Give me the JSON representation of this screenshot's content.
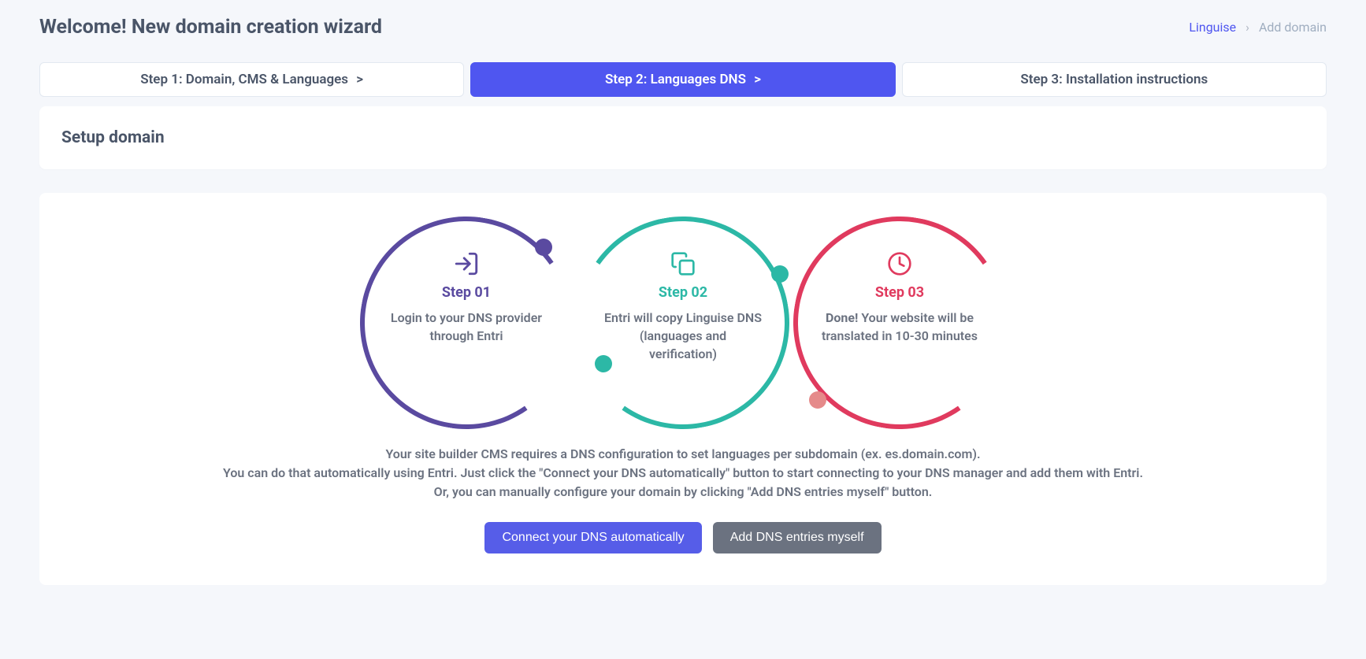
{
  "header": {
    "title": "Welcome! New domain creation wizard"
  },
  "breadcrumb": {
    "root": "Linguise",
    "current": "Add domain"
  },
  "tabs": {
    "step1": "Step 1: Domain, CMS & Languages",
    "step2": "Step 2: Languages DNS",
    "step3": "Step 3: Installation instructions",
    "chevron": ">"
  },
  "card": {
    "title": "Setup domain"
  },
  "diagram": {
    "step1_label": "Step 01",
    "step1_desc": "Login to your DNS provider through Entri",
    "step2_label": "Step 02",
    "step2_desc": "Entri will copy Linguise DNS (languages and verification)",
    "step3_label": "Step 03",
    "step3_strong": "Done!",
    "step3_rest": " Your website will be translated in 10-30 minutes"
  },
  "explain": {
    "line1": "Your site builder CMS requires a DNS configuration to set languages per subdomain (ex. es.domain.com).",
    "line2": "You can do that automatically using Entri. Just click the \"Connect your DNS automatically\" button to start connecting to your DNS manager and add them with Entri.",
    "line3": "Or, you can manually configure your domain by clicking \"Add DNS entries myself\" button."
  },
  "buttons": {
    "connect": "Connect your DNS automatically",
    "manual": "Add DNS entries myself"
  }
}
